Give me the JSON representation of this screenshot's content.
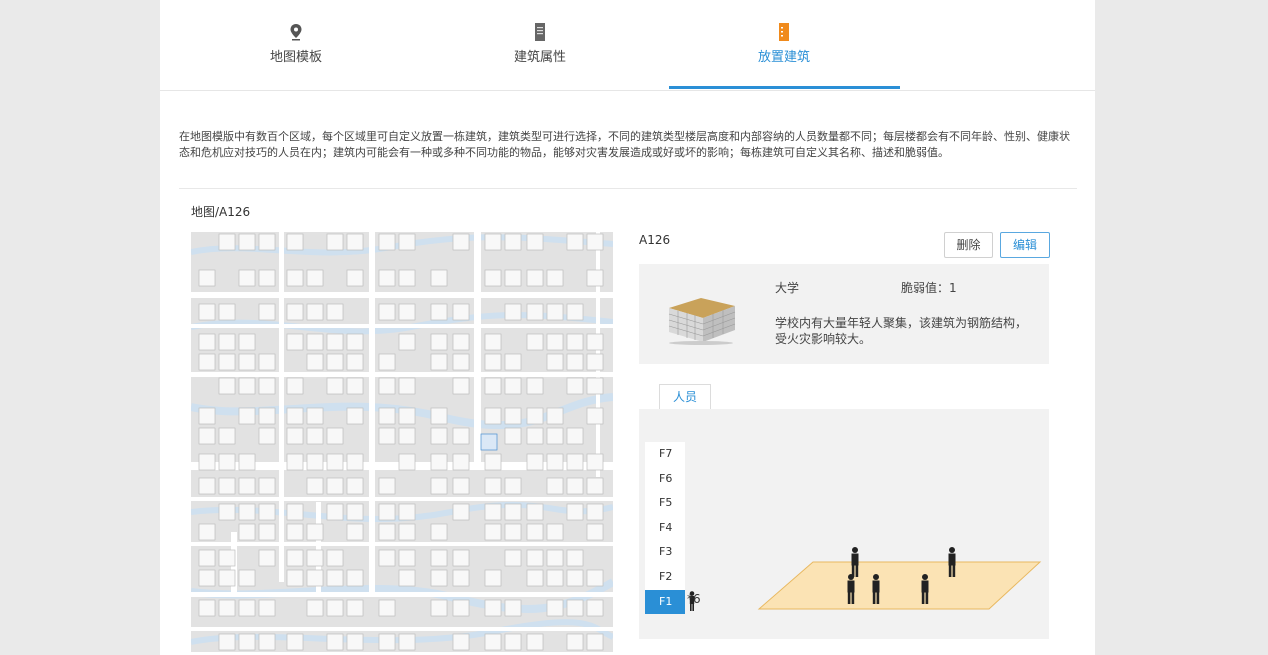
{
  "tabs": [
    {
      "label": "地图模板",
      "icon": "location-pin-icon"
    },
    {
      "label": "建筑属性",
      "icon": "building-icon"
    },
    {
      "label": "放置建筑",
      "icon": "building-icon",
      "active": true
    }
  ],
  "description": "在地图模版中有数百个区域，每个区域里可自定义放置一栋建筑，建筑类型可进行选择，不同的建筑类型楼层高度和内部容纳的人员数量都不同；每层楼都会有不同年龄、性别、健康状态和危机应对技巧的人员在内；建筑内可能会有一种或多种不同功能的物品，能够对灾害发展造成或好或坏的影响；每栋建筑可自定义其名称、描述和脆弱值。",
  "breadcrumb": "地图/A126",
  "building": {
    "code": "A126",
    "delete_label": "删除",
    "edit_label": "编辑",
    "name": "大学",
    "vulnerability": "脆弱值：1",
    "description": "学校内有大量年轻人聚集，该建筑为钢筋结构，受火灾影响较大。"
  },
  "people_tab": "人员",
  "floors": [
    "F7",
    "F6",
    "F5",
    "F4",
    "F3",
    "F2",
    "F1"
  ],
  "selected_floor": "F1",
  "person_count": "*6",
  "colors": {
    "accent": "#2a8fd6",
    "floor_fill": "#fbe3b4",
    "floor_stroke": "#e8b860",
    "map_bg": "#e2e2e2",
    "river": "#cfe0ef"
  }
}
